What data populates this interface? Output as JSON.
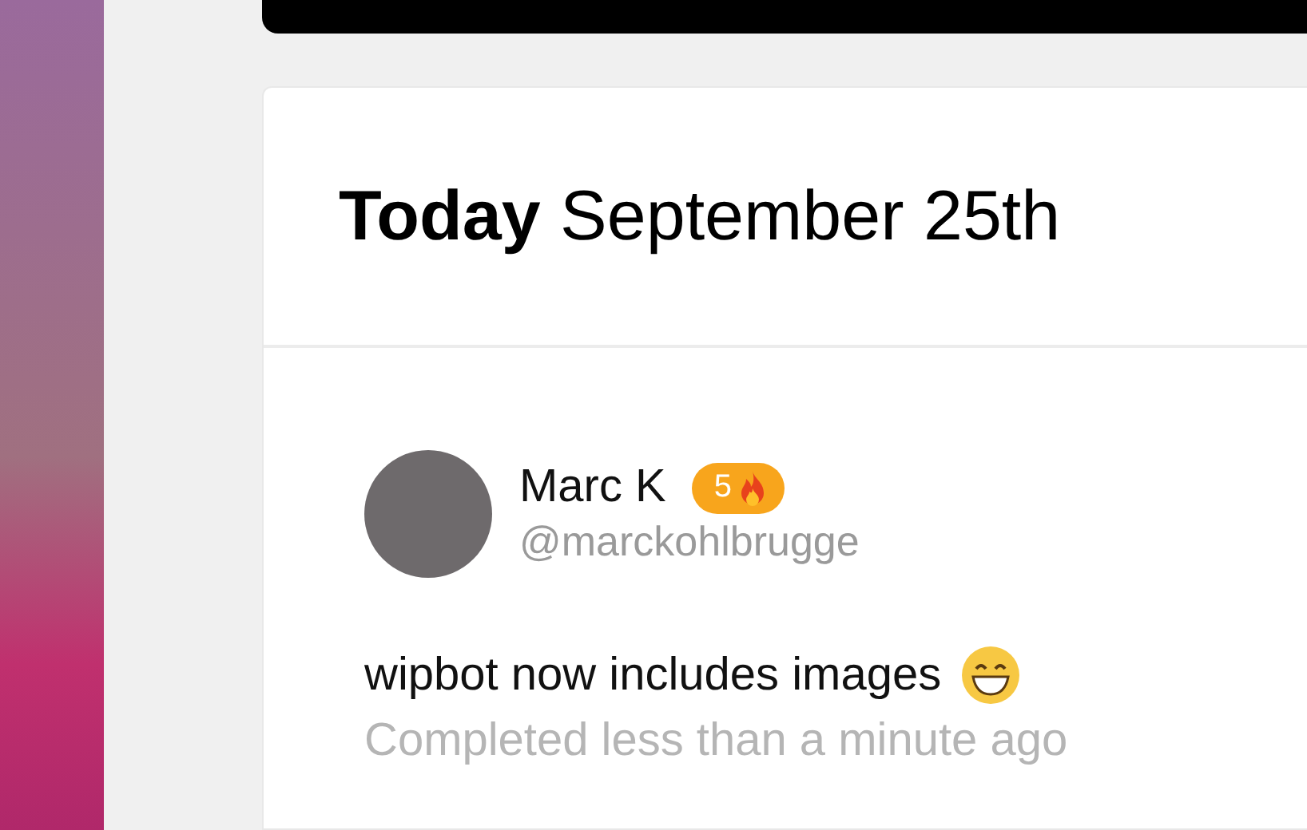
{
  "heading": "**Today** September 25th",
  "post": {
    "name": "Marc K",
    "streak": "5",
    "handle": "@marckohlbrugge",
    "text": "wipbot now includes images",
    "status": "Completed less than a minute ago"
  }
}
